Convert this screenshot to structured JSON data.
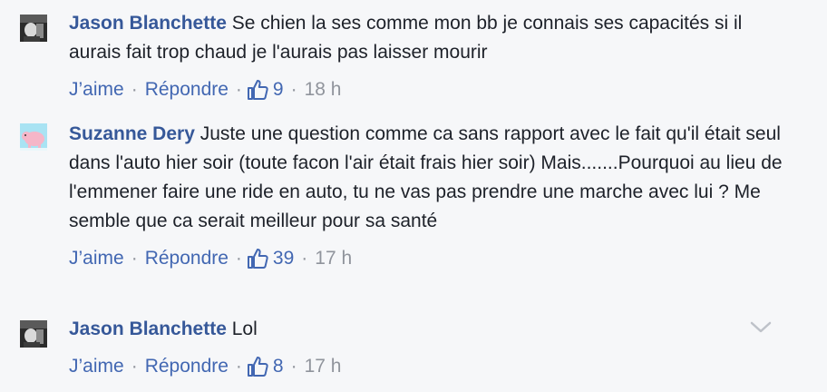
{
  "comments": [
    {
      "author": "Jason Blanchette",
      "text": "Se chien la ses comme mon bb je connais ses capacités si il aurais fait trop chaud je l'aurais pas laisser mourir",
      "like_label": "J’aime",
      "reply_label": "Répondre",
      "separator": "·",
      "likes": "9",
      "time": "18 h"
    },
    {
      "author": "Suzanne Dery",
      "text": "Juste une question comme ca sans rapport avec le fait qu'il était seul dans l'auto hier soir (toute facon l'air était frais hier soir) Mais.......Pourquoi au lieu de l'emmener faire une ride en auto, tu ne vas pas prendre une marche avec lui ? Me semble que ca serait meilleur pour sa santé",
      "like_label": "J’aime",
      "reply_label": "Répondre",
      "separator": "·",
      "likes": "39",
      "time": "17 h"
    },
    {
      "author": "Jason Blanchette",
      "text": "Lol",
      "like_label": "J’aime",
      "reply_label": "Répondre",
      "separator": "·",
      "likes": "8",
      "time": "17 h"
    }
  ],
  "icons": {
    "like": "thumbs-up-icon",
    "menu": "chevron-down-icon"
  },
  "colors": {
    "author": "#365899",
    "link": "#4267b2",
    "meta": "#90949c",
    "text": "#1d2129",
    "background": "#f6f7f9"
  }
}
